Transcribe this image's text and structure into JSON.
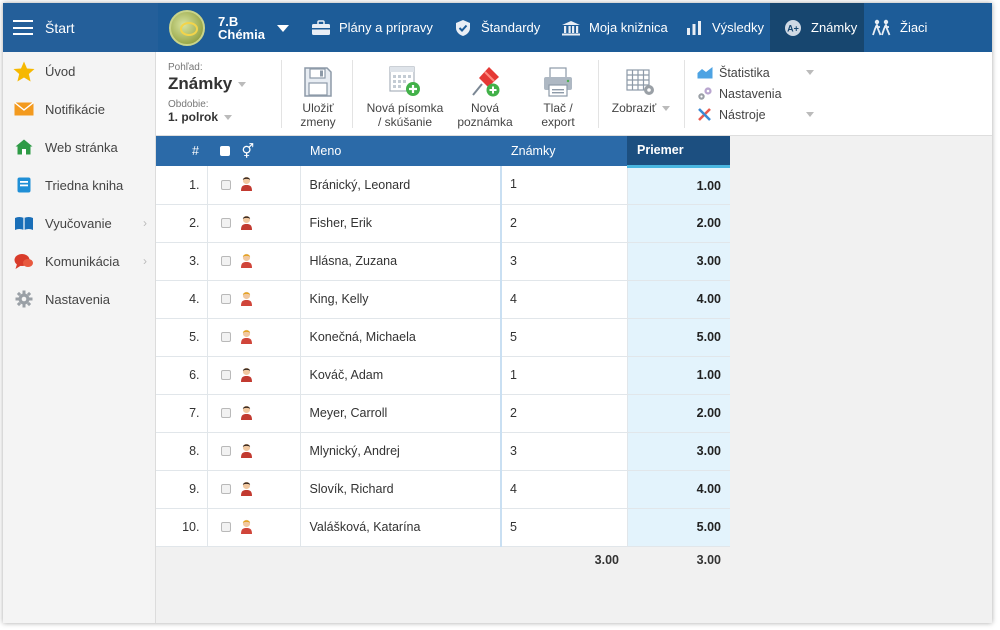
{
  "topbar": {
    "start_label": "Štart",
    "class_name": "7.B",
    "class_subject": "Chémia",
    "tabs": [
      {
        "label": "Plány a prípravy",
        "icon": "briefcase-icon"
      },
      {
        "label": "Štandardy",
        "icon": "shield-check-icon"
      },
      {
        "label": "Moja knižnica",
        "icon": "library-icon"
      },
      {
        "label": "Výsledky",
        "icon": "bar-chart-icon"
      },
      {
        "label": "Známky",
        "icon": "grade-a-icon",
        "active": true
      },
      {
        "label": "Žiaci",
        "icon": "students-icon"
      }
    ]
  },
  "sidebar": {
    "items": [
      {
        "label": "Úvod",
        "icon": "star-icon"
      },
      {
        "label": "Notifikácie",
        "icon": "envelope-icon"
      },
      {
        "label": "Web stránka",
        "icon": "home-icon"
      },
      {
        "label": "Triedna kniha",
        "icon": "book-icon"
      },
      {
        "label": "Vyučovanie",
        "icon": "open-book-icon",
        "chevron": true
      },
      {
        "label": "Komunikácia",
        "icon": "chat-icon",
        "chevron": true
      },
      {
        "label": "Nastavenia",
        "icon": "gear-icon"
      }
    ]
  },
  "toolbar": {
    "view_label": "Pohľad:",
    "view_value": "Známky",
    "period_label": "Obdobie:",
    "period_value": "1. polrok",
    "save_line1": "Uložiť",
    "save_line2": "zmeny",
    "new_exam_line1": "Nová písomka",
    "new_exam_line2": "/ skúšanie",
    "new_note_line1": "Nová",
    "new_note_line2": "poznámka",
    "print_line1": "Tlač /",
    "print_line2": "export",
    "display_label": "Zobraziť",
    "statistics_label": "Štatistika",
    "settings_label": "Nastavenia",
    "tools_label": "Nástroje"
  },
  "table": {
    "headers": {
      "num": "#",
      "name": "Meno",
      "grades": "Známky",
      "average": "Priemer"
    },
    "rows": [
      {
        "num": "1.",
        "name": "Bránický, Leonard",
        "grade": "1",
        "avg": "1.00",
        "gender": "male"
      },
      {
        "num": "2.",
        "name": "Fisher, Erik",
        "grade": "2",
        "avg": "2.00",
        "gender": "male"
      },
      {
        "num": "3.",
        "name": "Hlásna, Zuzana",
        "grade": "3",
        "avg": "3.00",
        "gender": "female"
      },
      {
        "num": "4.",
        "name": "King, Kelly",
        "grade": "4",
        "avg": "4.00",
        "gender": "female"
      },
      {
        "num": "5.",
        "name": "Konečná, Michaela",
        "grade": "5",
        "avg": "5.00",
        "gender": "female"
      },
      {
        "num": "6.",
        "name": "Kováč, Adam",
        "grade": "1",
        "avg": "1.00",
        "gender": "male"
      },
      {
        "num": "7.",
        "name": "Meyer, Carroll",
        "grade": "2",
        "avg": "2.00",
        "gender": "male"
      },
      {
        "num": "8.",
        "name": "Mlynický, Andrej",
        "grade": "3",
        "avg": "3.00",
        "gender": "male"
      },
      {
        "num": "9.",
        "name": "Slovík, Richard",
        "grade": "4",
        "avg": "4.00",
        "gender": "male"
      },
      {
        "num": "10.",
        "name": "Valášková, Katarína",
        "grade": "5",
        "avg": "5.00",
        "gender": "female"
      }
    ],
    "footer": {
      "grades_avg": "3.00",
      "average": "3.00"
    }
  },
  "colors": {
    "topbar": "#1d5c98",
    "active_tab": "#17466f",
    "header": "#2b6aa8",
    "priemer_header": "#1c4f80",
    "avg_cell": "#e3f3fc"
  }
}
